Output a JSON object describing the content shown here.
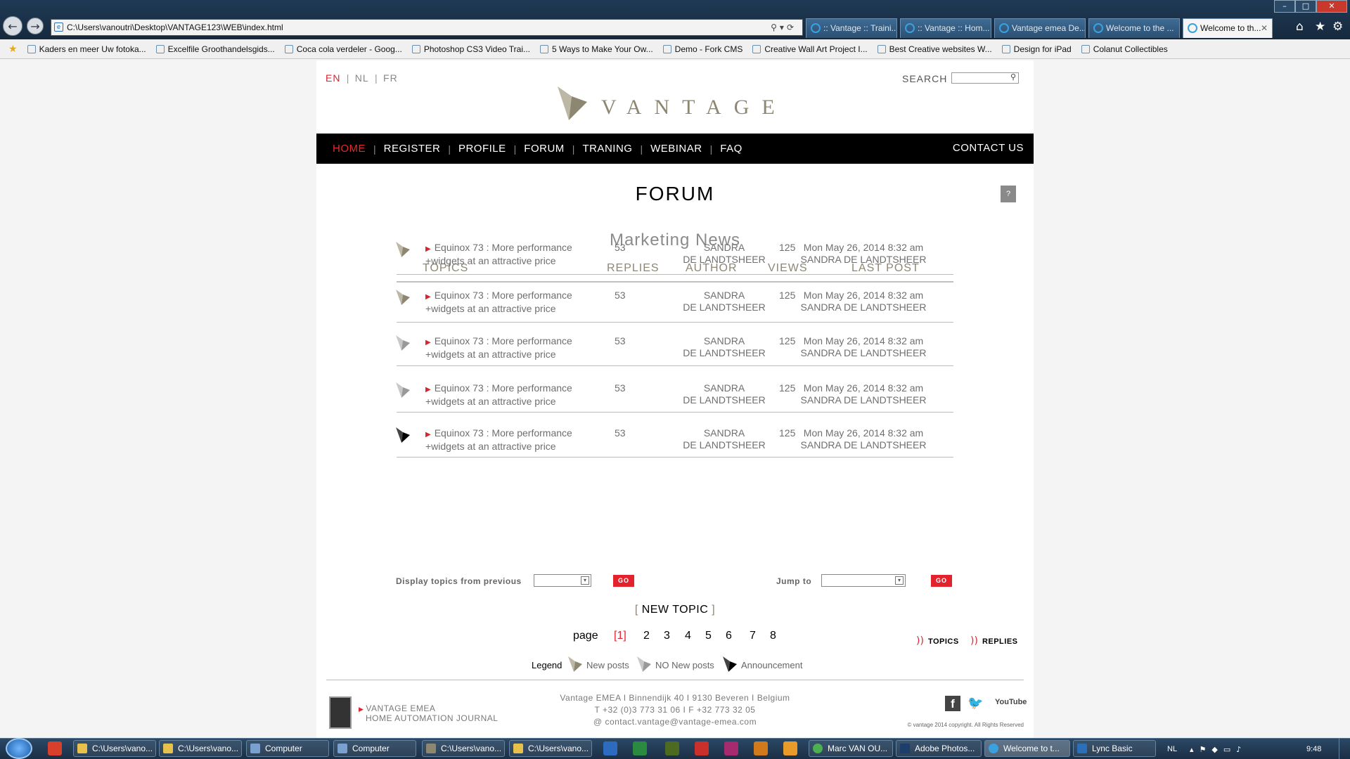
{
  "browser": {
    "address": "C:\\Users\\vanoutri\\Desktop\\VANTAGE123\\WEB\\index.html",
    "tabs": [
      ":: Vantage :: Traini...",
      ":: Vantage :: Hom...",
      "Vantage emea De...",
      "Welcome to the ...",
      "Welcome to th..."
    ],
    "favorites": [
      "Kaders en meer Uw fotoka...",
      "Excelfile Groothandelsgids...",
      "Coca cola verdeler - Goog...",
      "Photoshop CS3 Video Trai...",
      "5 Ways to Make Your Ow...",
      "Demo - Fork CMS",
      "Creative Wall Art Project I...",
      "Best Creative websites  W...",
      "Design for iPad",
      "Colanut Collectibles"
    ]
  },
  "header": {
    "languages": [
      "EN",
      "NL",
      "FR"
    ],
    "search_label": "SEARCH",
    "logo_text": "VANTAGE"
  },
  "nav": {
    "items": [
      "HOME",
      "REGISTER",
      "PROFILE",
      "FORUM",
      "TRANING",
      "WEBINAR",
      "FAQ"
    ],
    "contact": "CONTACT US"
  },
  "forum": {
    "title": "FORUM",
    "help": "?",
    "section": "Marketing News",
    "columns": [
      "TOPICS",
      "REPLIES",
      "AUTHOR",
      "VIEWS",
      "LAST POST"
    ],
    "rows": [
      {
        "topic1": "Equinox 73 : More performance",
        "topic2": "+widgets at an attractive price",
        "replies": "53",
        "author1": "SANDRA",
        "author2": "DE LANDTSHEER",
        "views": "125",
        "date": "Mon May 26, 2014 8:32 am",
        "by": "SANDRA DE LANDTSHEER",
        "icon": "new-posts"
      },
      {
        "topic1": "Equinox 73 : More performance",
        "topic2": "+widgets at an attractive price",
        "replies": "53",
        "author1": "SANDRA",
        "author2": "DE LANDTSHEER",
        "views": "125",
        "date": "Mon May 26, 2014 8:32 am",
        "by": "SANDRA DE LANDTSHEER",
        "icon": "new-posts"
      },
      {
        "topic1": "Equinox 73 : More performance",
        "topic2": "+widgets at an attractive price",
        "replies": "53",
        "author1": "SANDRA",
        "author2": "DE LANDTSHEER",
        "views": "125",
        "date": "Mon May 26, 2014 8:32 am",
        "by": "SANDRA DE LANDTSHEER",
        "icon": "no-new-posts"
      },
      {
        "topic1": "Equinox 73 : More performance",
        "topic2": "+widgets at an attractive price",
        "replies": "53",
        "author1": "SANDRA",
        "author2": "DE LANDTSHEER",
        "views": "125",
        "date": "Mon May 26, 2014 8:32 am",
        "by": "SANDRA DE LANDTSHEER",
        "icon": "no-new-posts"
      },
      {
        "topic1": "Equinox 73 : More performance",
        "topic2": "+widgets at an attractive price",
        "replies": "53",
        "author1": "SANDRA",
        "author2": "DE LANDTSHEER",
        "views": "125",
        "date": "Mon May 26, 2014 8:32 am",
        "by": "SANDRA DE LANDTSHEER",
        "icon": "announcement"
      }
    ],
    "display_label": "Display topics from previous",
    "jump_label": "Jump to",
    "go": "GO",
    "new_topic": "NEW TOPIC",
    "page_label": "page",
    "pages": [
      "1",
      "2",
      "3",
      "4",
      "5",
      "6",
      "7",
      "8"
    ],
    "current_page": "1",
    "rss_topics": "TOPICS",
    "rss_replies": "REPLIES",
    "legend_label": "Legend",
    "legend": [
      "New posts",
      "NO New posts",
      "Announcement"
    ]
  },
  "footer": {
    "brand1": "VANTAGE EMEA",
    "brand2": "HOME AUTOMATION JOURNAL",
    "address": "Vantage EMEA I Binnendijk 40 I 9130 Beveren I Belgium",
    "phone": "T +32 (0)3 773 31 06 I F +32 773 32 05",
    "email": "@ contact.vantage@vantage-emea.com",
    "copyright": "©  vantage 2014 copyright. All Rights Reserved",
    "youtube": "YouTube"
  },
  "taskbar": {
    "items": [
      "C:\\Users\\vano...",
      "C:\\Users\\vano...",
      "Computer",
      "Computer",
      "C:\\Users\\vano...",
      "C:\\Users\\vano...",
      "Marc VAN OU...",
      "Adobe Photos...",
      "Welcome to t...",
      "Lync Basic"
    ],
    "lang": "NL",
    "time": "9:48"
  },
  "colors": {
    "accent": "#e2232e",
    "brand": "#8d8771",
    "nav": "#000000"
  }
}
